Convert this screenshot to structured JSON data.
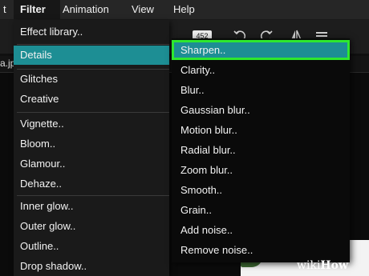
{
  "menubar": {
    "items": [
      "t",
      "Filter",
      "Animation",
      "View",
      "Help"
    ],
    "active": "Filter"
  },
  "toolbar": {
    "zoom_value": "452",
    "icons": [
      "undo-icon",
      "redo-icon",
      "flip-icon",
      "layers-icon"
    ]
  },
  "tab": {
    "filename": "a.jp"
  },
  "filter_menu": {
    "items": [
      "Effect library..",
      "Details",
      "Glitches",
      "Creative",
      "Vignette..",
      "Bloom..",
      "Glamour..",
      "Dehaze..",
      "Inner glow..",
      "Outer glow..",
      "Outline..",
      "Drop shadow.."
    ],
    "highlighted": "Details"
  },
  "details_submenu": {
    "items": [
      "Sharpen..",
      "Clarity..",
      "Blur..",
      "Gaussian blur..",
      "Motion blur..",
      "Radial blur..",
      "Zoom blur..",
      "Smooth..",
      "Grain..",
      "Add noise..",
      "Remove noise.."
    ],
    "highlighted": "Sharpen.."
  },
  "colors": {
    "highlight": "#1d8e94",
    "focus_outline": "#2ee82e",
    "menubar_bg": "#262626",
    "menu_bg": "#1a1a1a"
  },
  "watermark": {
    "prefix": "wiki",
    "suffix": "How"
  }
}
